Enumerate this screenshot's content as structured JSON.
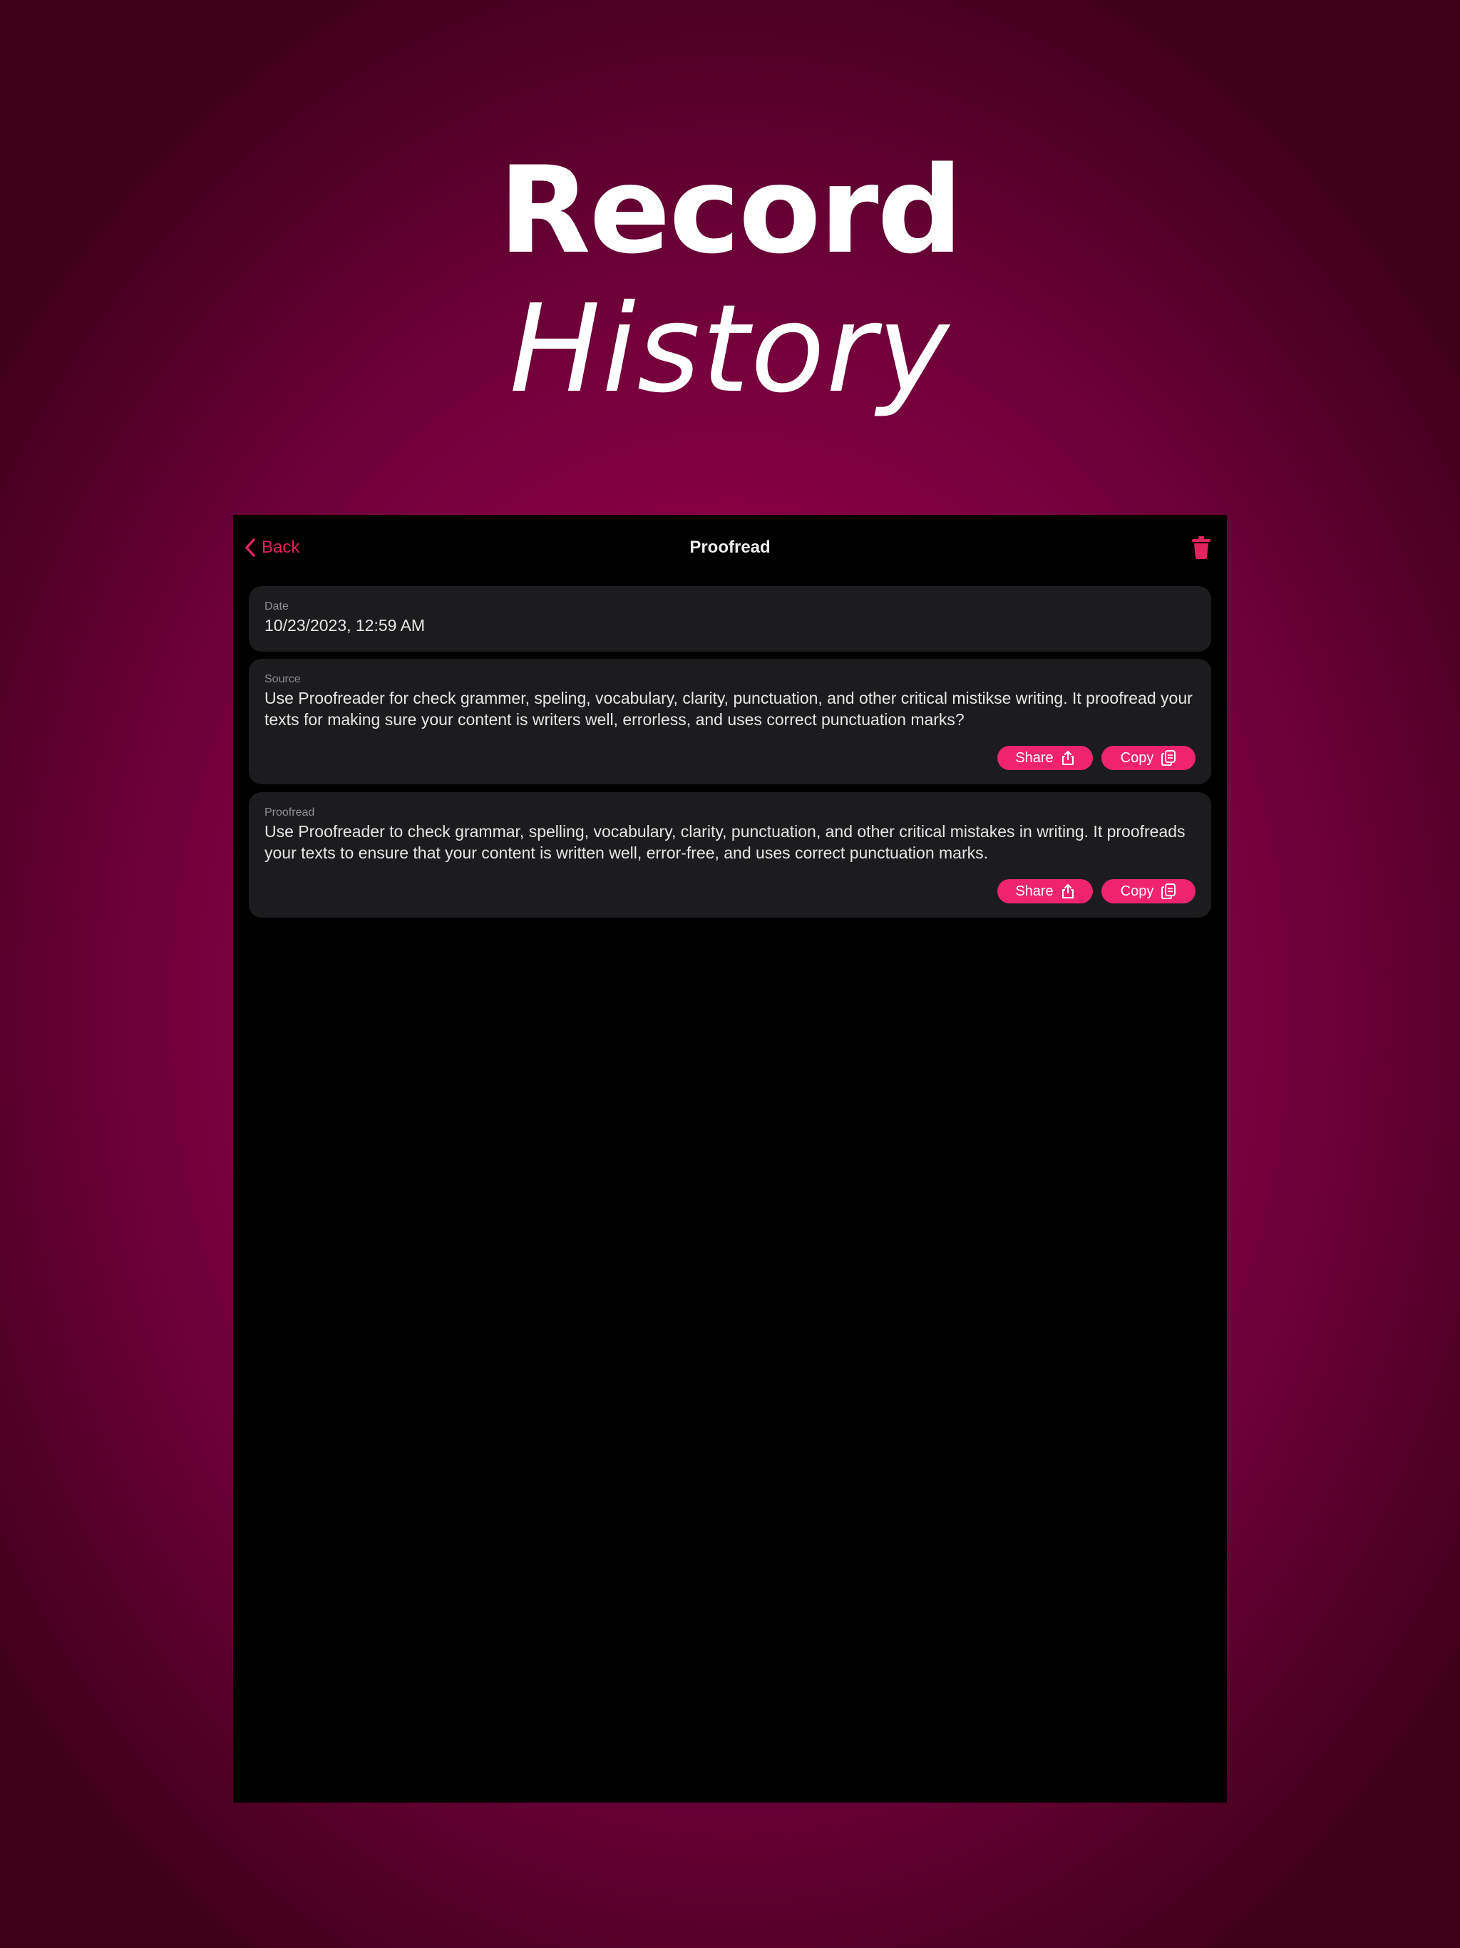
{
  "headline": {
    "line1": "Record",
    "line2": "History"
  },
  "nav": {
    "back_label": "Back",
    "title": "Proofread",
    "trash_icon": "trash-icon"
  },
  "date_card": {
    "label": "Date",
    "value": "10/23/2023, 12:59 AM"
  },
  "source_card": {
    "label": "Source",
    "text": "Use Proofreader for check grammer, speling, vocabulary, clarity, punctuation, and other critical mistikse writing. It proofread your texts for making sure your content is writers well, errorless, and uses correct punctuation marks?",
    "share_label": "Share",
    "copy_label": "Copy"
  },
  "proofread_card": {
    "label": "Proofread",
    "text": "Use Proofreader to check grammar, spelling, vocabulary, clarity, punctuation, and other critical mistakes in writing. It proofreads your texts to ensure that your content is written well, error-free, and uses correct punctuation marks.",
    "share_label": "Share",
    "copy_label": "Copy"
  },
  "colors": {
    "accent": "#f0246e",
    "back_tint": "#e0245e",
    "card_bg": "#1c1c1e",
    "screen_bg": "#000000",
    "background_center": "#a30050",
    "background_edge": "#3f0019"
  },
  "icons": [
    "chevron-left-icon",
    "trash-icon",
    "share-icon",
    "copy-icon"
  ]
}
